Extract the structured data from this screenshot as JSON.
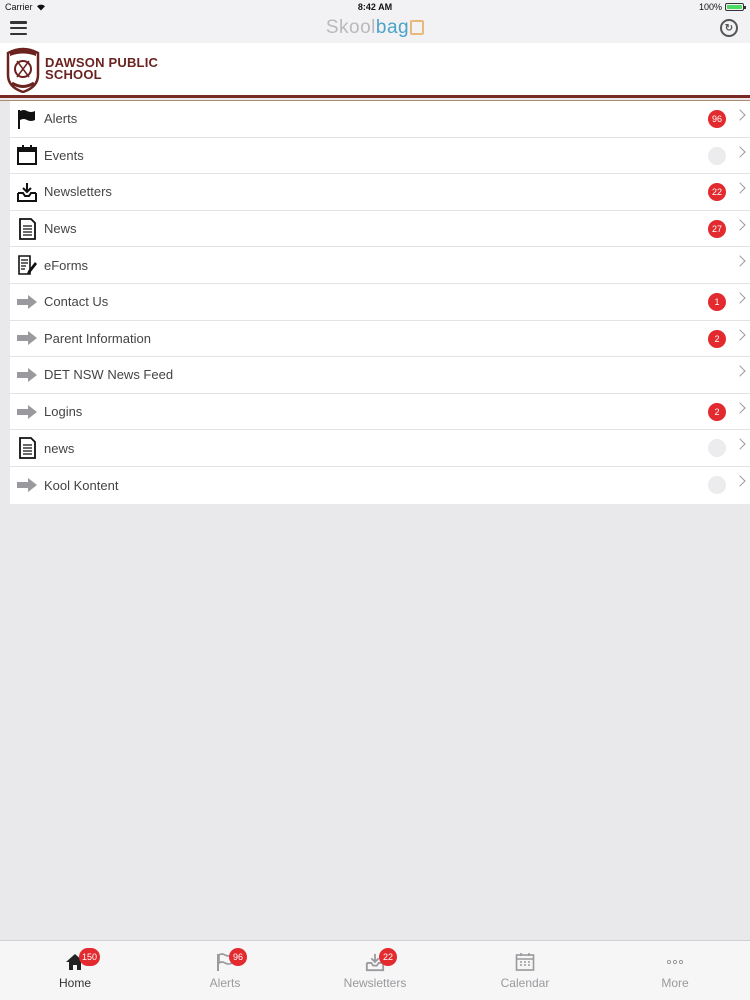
{
  "status_bar": {
    "carrier": "Carrier",
    "time": "8:42 AM",
    "battery": "100%"
  },
  "header": {
    "logo_part1": "Skool",
    "logo_part2": "bag"
  },
  "school": {
    "name_line1": "DAWSON PUBLIC",
    "name_line2": "SCHOOL"
  },
  "menu": {
    "items": [
      {
        "label": "Alerts",
        "icon": "flag-icon",
        "badge": "96"
      },
      {
        "label": "Events",
        "icon": "calendar-icon",
        "badge": ""
      },
      {
        "label": "Newsletters",
        "icon": "inbox-download-icon",
        "badge": "22"
      },
      {
        "label": "News",
        "icon": "document-icon",
        "badge": "27"
      },
      {
        "label": "eForms",
        "icon": "form-edit-icon",
        "badge": null
      },
      {
        "label": "Contact Us",
        "icon": "arrow-right-icon",
        "badge": "1"
      },
      {
        "label": "Parent Information",
        "icon": "arrow-right-icon",
        "badge": "2"
      },
      {
        "label": "DET NSW News Feed",
        "icon": "arrow-right-icon",
        "badge": null
      },
      {
        "label": "Logins",
        "icon": "arrow-right-icon",
        "badge": "2"
      },
      {
        "label": "news",
        "icon": "document-icon",
        "badge": ""
      },
      {
        "label": "Kool Kontent",
        "icon": "arrow-right-icon",
        "badge": ""
      }
    ]
  },
  "tabs": [
    {
      "label": "Home",
      "icon": "home-icon",
      "badge": "150",
      "active": true
    },
    {
      "label": "Alerts",
      "icon": "flag-icon",
      "badge": "96",
      "active": false
    },
    {
      "label": "Newsletters",
      "icon": "inbox-download-icon",
      "badge": "22",
      "active": false
    },
    {
      "label": "Calendar",
      "icon": "calendar-icon",
      "badge": null,
      "active": false
    },
    {
      "label": "More",
      "icon": "more-dots-icon",
      "badge": null,
      "active": false
    }
  ],
  "colors": {
    "badge": "#e22a2f",
    "school_maroon": "#7a2a24",
    "logo_blue": "#4aa3c8"
  }
}
